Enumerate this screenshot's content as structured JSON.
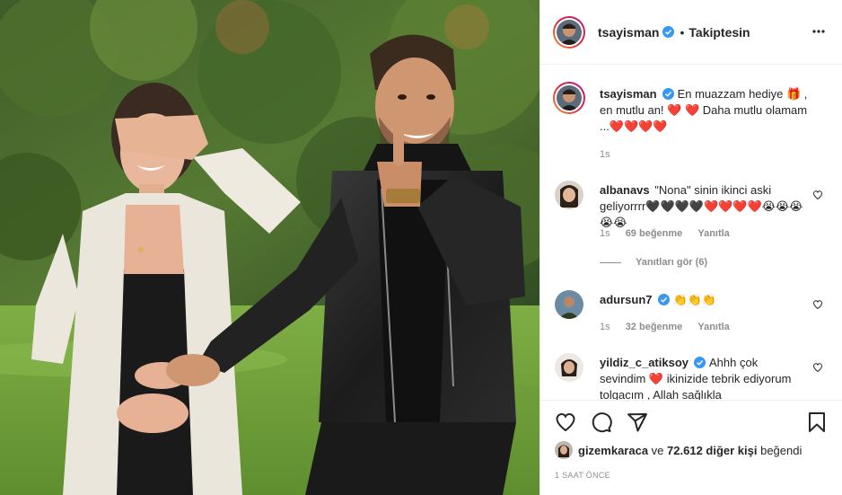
{
  "post": {
    "author": "tsayisman",
    "follow_state": "Takiptesin",
    "separator": "•"
  },
  "caption": {
    "username": "tsayisman",
    "text_line1": "En muazzam hediye 🎁 ,",
    "text_line2": "en mutlu an! ❤️ ❤️ Daha mutlu olamam",
    "text_line3": "...❤️❤️❤️❤️",
    "time": "1s"
  },
  "comments": [
    {
      "username": "albanavs",
      "text": "\"Nona\" sinin ikinci aski geliyorrrr🖤🖤🖤🖤❤️❤️❤️❤️😭😭😭😭😭",
      "time": "1s",
      "likes": "69 beğenme",
      "reply": "Yanıtla"
    },
    {
      "username": "adursun7",
      "text": "👏👏👏",
      "time": "1s",
      "likes": "32 beğenme",
      "reply": "Yanıtla"
    },
    {
      "username": "yildiz_c_atiksoy",
      "text": "Ahhh çok sevindim ❤️ ikinizide tebrik ediyorum tolgacım , Allah sağlıkla"
    }
  ],
  "replies_label": "Yanıtları gör (6)",
  "likes": {
    "user": "gizemkaraca",
    "connector": " ve ",
    "others": "72.612 diğer kişi",
    "suffix": " beğendi"
  },
  "timestamp": "1 SAAT ÖNCE",
  "icons": {
    "more": "more-options-icon",
    "like": "heart-icon",
    "comment": "comment-icon",
    "share": "share-icon",
    "save": "bookmark-icon",
    "verified": "verified-badge-icon"
  },
  "colors": {
    "verified": "#3897f0",
    "muted": "#8e8e8e",
    "text": "#262626",
    "border": "#efefef"
  }
}
